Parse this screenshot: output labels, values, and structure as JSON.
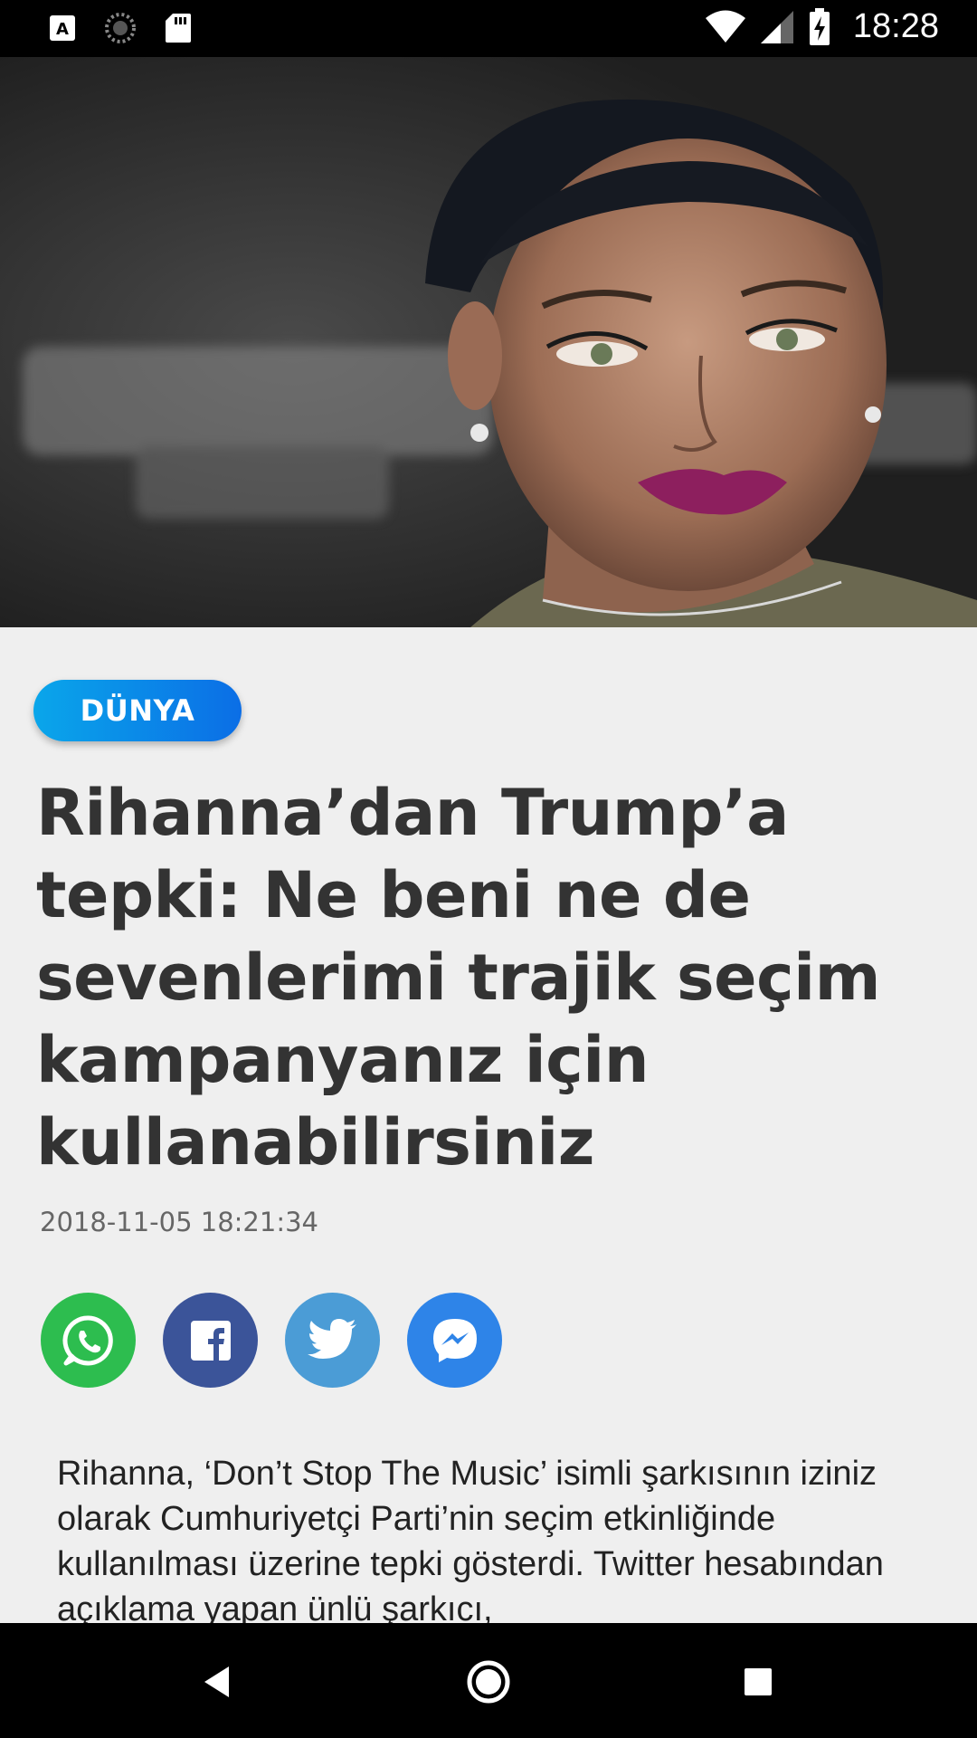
{
  "status_bar": {
    "time": "18:28",
    "icons": [
      "a-notification-icon",
      "loading-icon",
      "sd-card-icon",
      "wifi-icon",
      "signal-icon",
      "battery-charging-icon"
    ]
  },
  "hero": {
    "icon": "article-photo"
  },
  "article": {
    "category": "DÜNYA",
    "title": "Rihanna’dan Trump’a tepki: Ne beni ne de sevenlerimi trajik seçim kampanyanız için kullanabilirsiniz",
    "date": "2018-11-05 18:21:34",
    "body": "Rihanna, ‘Don’t Stop The Music’ isimli şarkısının iziniz olarak Cumhuriyetçi Parti’nin seçim etkinliğinde kullanılması üzerine tepki gösterdi. Twitter hesabından açıklama yapan ünlü şarkıcı,"
  },
  "share": {
    "buttons": [
      {
        "name": "whatsapp",
        "color": "#2dbd4f"
      },
      {
        "name": "facebook",
        "color": "#3b5499"
      },
      {
        "name": "twitter",
        "color": "#4b9cd6"
      },
      {
        "name": "messenger",
        "color": "#2e84e8"
      }
    ]
  },
  "nav": {
    "buttons": [
      "back-icon",
      "home-icon",
      "recents-icon"
    ]
  }
}
